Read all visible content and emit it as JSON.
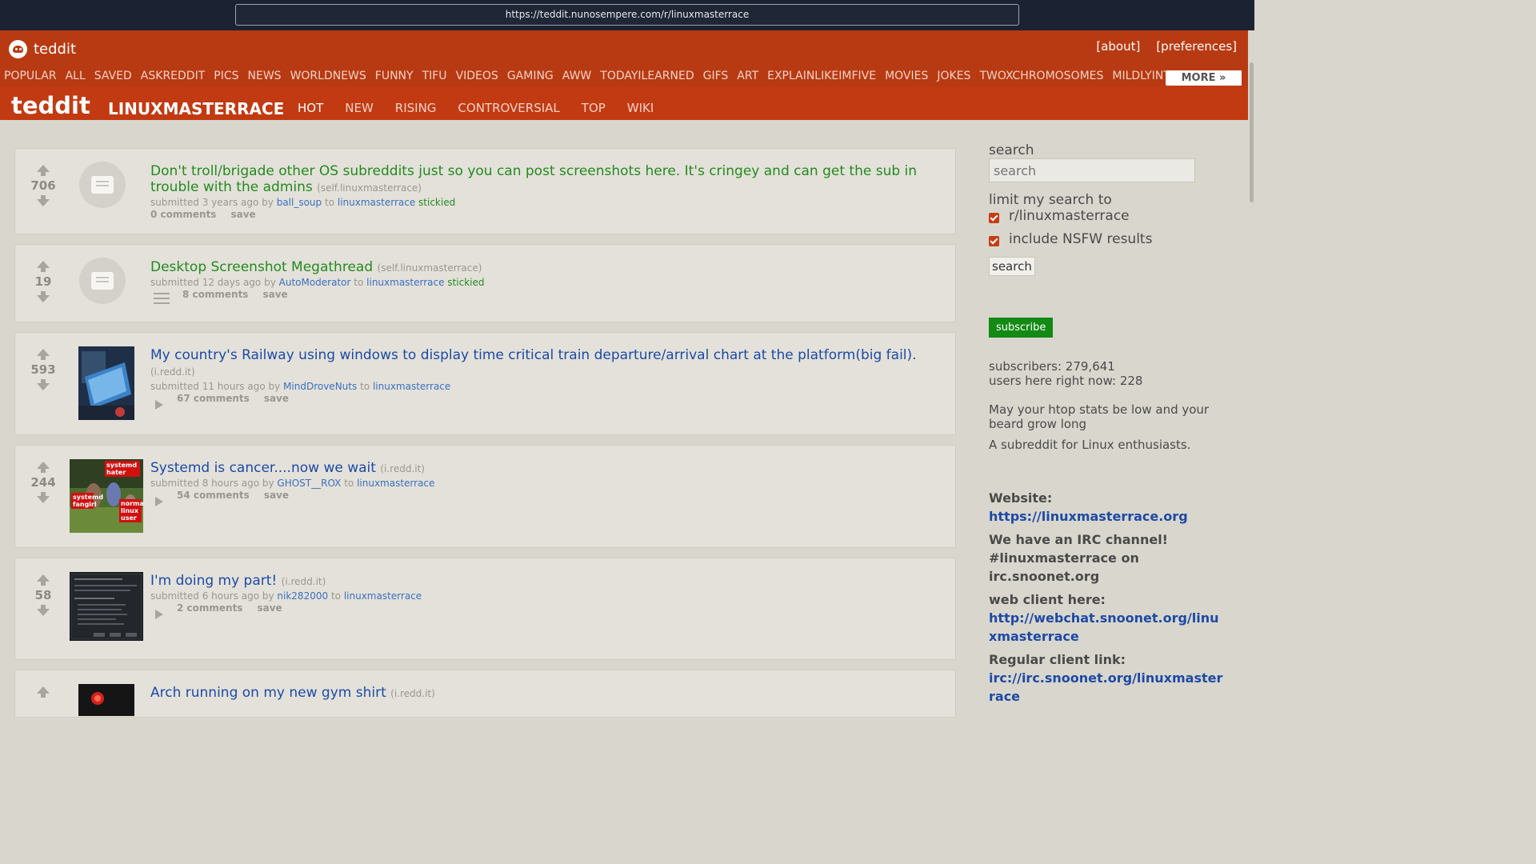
{
  "browser": {
    "url": "https://teddit.nunosempere.com/r/linuxmasterrace"
  },
  "header": {
    "brand": "teddit",
    "links": [
      "[about]",
      "[preferences]"
    ]
  },
  "subnav": {
    "items": [
      "POPULAR",
      "ALL",
      "SAVED",
      "ASKREDDIT",
      "PICS",
      "NEWS",
      "WORLDNEWS",
      "FUNNY",
      "TIFU",
      "VIDEOS",
      "GAMING",
      "AWW",
      "TODAYILEARNED",
      "GIFS",
      "ART",
      "EXPLAINLIKEIMFIVE",
      "MOVIES",
      "JOKES",
      "TWOXCHROMOSOMES",
      "MILDLYINTE"
    ],
    "more": "MORE »"
  },
  "subreddit": {
    "brand": "teddit",
    "name": "LINUXMASTERRACE",
    "sorts": [
      "HOT",
      "NEW",
      "RISING",
      "CONTROVERSIAL",
      "TOP",
      "WIKI"
    ]
  },
  "posts": [
    {
      "score": "706",
      "title": "Don't troll/brigade other OS subreddits just so you can post screenshots here. It's cringey and can get the sub in trouble with the admins",
      "domain": "(self.linuxmasterrace)",
      "submitted": "submitted 3 years ago by",
      "author": "ball_soup",
      "to": "to",
      "sub": "linuxmasterrace",
      "stickied": "stickied",
      "comments": "0 comments",
      "save": "save"
    },
    {
      "score": "19",
      "title": "Desktop Screenshot Megathread",
      "domain": "(self.linuxmasterrace)",
      "submitted": "submitted 12 days ago by",
      "author": "AutoModerator",
      "to": "to",
      "sub": "linuxmasterrace",
      "stickied": "stickied",
      "comments": "8 comments",
      "save": "save"
    },
    {
      "score": "593",
      "title": "My country's Railway using windows to display time critical train departure/arrival chart at the platform(big fail).",
      "domain": "(i.redd.it)",
      "submitted": "submitted 11 hours ago by",
      "author": "MindDroveNuts",
      "to": "to",
      "sub": "linuxmasterrace",
      "comments": "67 comments",
      "save": "save"
    },
    {
      "score": "244",
      "title": "Systemd is cancer....now we wait",
      "domain": "(i.redd.it)",
      "submitted": "submitted 8 hours ago by",
      "author": "GHOST__ROX",
      "to": "to",
      "sub": "linuxmasterrace",
      "comments": "54 comments",
      "save": "save"
    },
    {
      "score": "58",
      "title": "I'm doing my part!",
      "domain": "(i.redd.it)",
      "submitted": "submitted 6 hours ago by",
      "author": "nik282000",
      "to": "to",
      "sub": "linuxmasterrace",
      "comments": "2 comments",
      "save": "save"
    },
    {
      "title": "Arch running on my new gym shirt",
      "domain": "(i.redd.it)"
    }
  ],
  "thumb_text": {
    "systemd_hater": "systemd hater",
    "systemd_fangirl": "systemd fangirl",
    "normal_linux_user": "normal linux user"
  },
  "sidebar": {
    "search_label": "search",
    "search_placeholder": "search",
    "limit_label": "limit my search to",
    "opt1": "r/linuxmasterrace",
    "opt2": "include NSFW results",
    "search_button": "search",
    "subscribe": "subscribe",
    "subscribers": "subscribers: 279,641",
    "online": "users here right now: 228",
    "tagline": "May your htop stats be low and your beard grow long",
    "about": "A subreddit for Linux enthusiasts.",
    "website_label": "Website:",
    "website_link": "https://linuxmasterrace.org",
    "irc_line1": "We have an IRC channel!",
    "irc_line2": "#linuxmasterrace on",
    "irc_line3": "irc.snoonet.org",
    "webclient_label": "web client here:",
    "webclient_link": "http://webchat.snoonet.org/linuxmasterrace",
    "regular_label": "Regular client link:",
    "regular_link": "irc://irc.snoonet.org/linuxmasterrace"
  },
  "colors": {
    "header": "#b83a12",
    "title_link": "#1d4aa6",
    "stickied": "#248a1f",
    "subscribe": "#128a13"
  }
}
